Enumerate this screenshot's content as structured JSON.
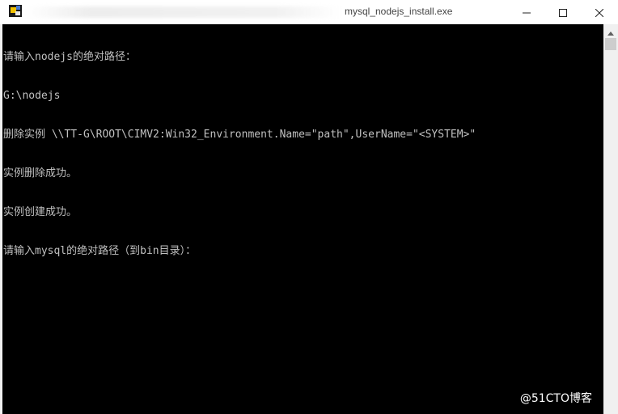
{
  "window": {
    "title": "mysql_nodejs_install.exe"
  },
  "console": {
    "lines": [
      "请输入nodejs的绝对路径：",
      "G:\\nodejs",
      "删除实例 \\\\TT-G\\ROOT\\CIMV2:Win32_Environment.Name=\"path\",UserName=\"<SYSTEM>\"",
      "实例删除成功。",
      "实例创建成功。",
      "请输入mysql的绝对路径（到bin目录）："
    ]
  },
  "watermark": "@51CTO博客",
  "icons": {
    "app": "app-icon",
    "minimize": "minimize-icon",
    "maximize": "maximize-icon",
    "close": "close-icon",
    "scroll_up": "scroll-up-arrow-icon"
  },
  "colors": {
    "console_bg": "#000000",
    "console_fg": "#c0c0c0",
    "titlebar_bg": "#ffffff"
  }
}
